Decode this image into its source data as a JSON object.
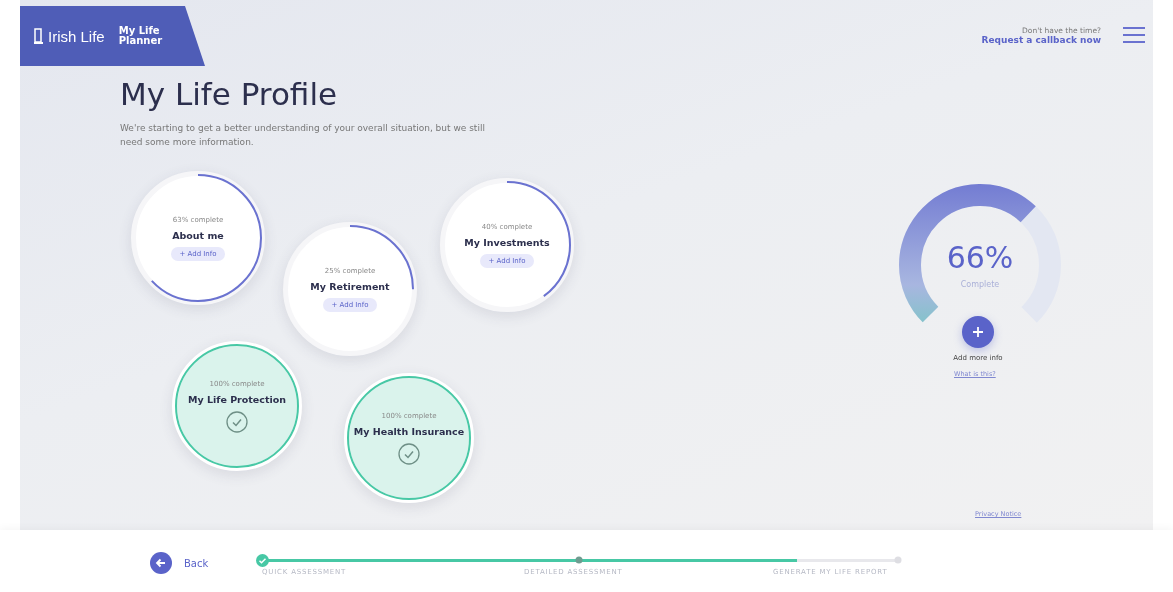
{
  "header": {
    "brand": "Irish Life",
    "product": "My Life Planner",
    "callback_prompt": "Don't have the time?",
    "callback_link": "Request a callback now"
  },
  "title": "My Life Profile",
  "intro": "We're starting to get a better understanding of your overall situation, but we still need some more information.",
  "sections": [
    {
      "progress": "63% complete",
      "name": "About me",
      "complete": false,
      "action": "+ Add Info"
    },
    {
      "progress": "25% complete",
      "name": "My Retirement",
      "complete": false,
      "action": "+ Add Info"
    },
    {
      "progress": "40% complete",
      "name": "My Investments",
      "complete": false,
      "action": "+ Add Info"
    },
    {
      "progress": "100% complete",
      "name": "My Life Protection",
      "complete": true
    },
    {
      "progress": "100% complete",
      "name": "My Health Insurance",
      "complete": true
    }
  ],
  "overall": {
    "percent": "66%",
    "caption": "Complete",
    "level": 0.66,
    "add_label": "Add more info",
    "help_link": "What is this?"
  },
  "privacy_link": "Privacy Notice",
  "footer": {
    "back": "Back",
    "level": 0.84,
    "steps": [
      {
        "label": "QUICK ASSESSMENT",
        "done": true
      },
      {
        "label": "DETAILED ASSESSMENT",
        "done": false
      },
      {
        "label": "GENERATE MY LIFE REPORT",
        "done": false
      }
    ]
  }
}
